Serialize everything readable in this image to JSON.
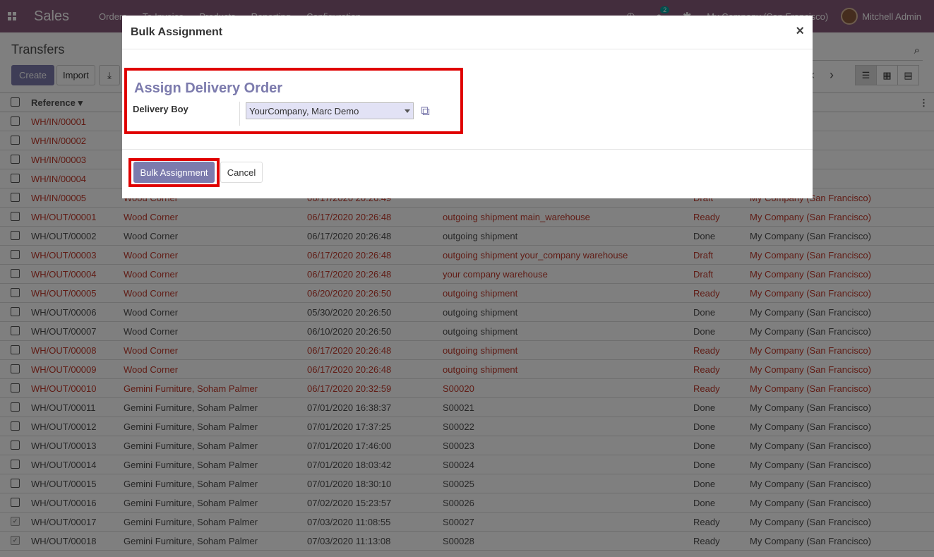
{
  "navbar": {
    "brand": "Sales",
    "menu": [
      "Orders",
      "To Invoice",
      "Products",
      "Reporting",
      "Configuration"
    ],
    "chat_badge": "2",
    "company": "My Company (San Francisco)",
    "user": "Mitchell Admin",
    "apps_icon": "apps-grid-icon",
    "clock_icon": "clock-icon",
    "chat_icon": "chat-icon",
    "settings_icon": "bug-icon"
  },
  "control_panel": {
    "breadcrumb": "Transfers",
    "create_label": "Create",
    "import_label": "Import"
  },
  "list": {
    "headers": {
      "reference": "Reference ▾"
    },
    "rows": [
      {
        "ref": "WH/IN/00001",
        "contact": "",
        "date": "",
        "doc": "",
        "status": "",
        "company": "San Francisco)",
        "red": true
      },
      {
        "ref": "WH/IN/00002",
        "contact": "",
        "date": "",
        "doc": "",
        "status": "",
        "company": "San Francisco)",
        "red": true
      },
      {
        "ref": "WH/IN/00003",
        "contact": "",
        "date": "",
        "doc": "",
        "status": "",
        "company": "San Francisco)",
        "red": true
      },
      {
        "ref": "WH/IN/00004",
        "contact": "",
        "date": "",
        "doc": "",
        "status": "",
        "company": "San Francisco)",
        "red": true
      },
      {
        "ref": "WH/IN/00005",
        "contact": "Wood Corner",
        "date": "06/17/2020 20:26:49",
        "doc": "",
        "status": "Draft",
        "company": "My Company (San Francisco)",
        "red": true
      },
      {
        "ref": "WH/OUT/00001",
        "contact": "Wood Corner",
        "date": "06/17/2020 20:26:48",
        "doc": "outgoing shipment main_warehouse",
        "status": "Ready",
        "company": "My Company (San Francisco)",
        "red": true
      },
      {
        "ref": "WH/OUT/00002",
        "contact": "Wood Corner",
        "date": "06/17/2020 20:26:48",
        "doc": "outgoing shipment",
        "status": "Done",
        "company": "My Company (San Francisco)",
        "red": false
      },
      {
        "ref": "WH/OUT/00003",
        "contact": "Wood Corner",
        "date": "06/17/2020 20:26:48",
        "doc": "outgoing shipment your_company warehouse",
        "status": "Draft",
        "company": "My Company (San Francisco)",
        "red": true
      },
      {
        "ref": "WH/OUT/00004",
        "contact": "Wood Corner",
        "date": "06/17/2020 20:26:48",
        "doc": "your company warehouse",
        "status": "Draft",
        "company": "My Company (San Francisco)",
        "red": true
      },
      {
        "ref": "WH/OUT/00005",
        "contact": "Wood Corner",
        "date": "06/20/2020 20:26:50",
        "doc": "outgoing shipment",
        "status": "Ready",
        "company": "My Company (San Francisco)",
        "red": true
      },
      {
        "ref": "WH/OUT/00006",
        "contact": "Wood Corner",
        "date": "05/30/2020 20:26:50",
        "doc": "outgoing shipment",
        "status": "Done",
        "company": "My Company (San Francisco)",
        "red": false
      },
      {
        "ref": "WH/OUT/00007",
        "contact": "Wood Corner",
        "date": "06/10/2020 20:26:50",
        "doc": "outgoing shipment",
        "status": "Done",
        "company": "My Company (San Francisco)",
        "red": false
      },
      {
        "ref": "WH/OUT/00008",
        "contact": "Wood Corner",
        "date": "06/17/2020 20:26:48",
        "doc": "outgoing shipment",
        "status": "Ready",
        "company": "My Company (San Francisco)",
        "red": true
      },
      {
        "ref": "WH/OUT/00009",
        "contact": "Wood Corner",
        "date": "06/17/2020 20:26:48",
        "doc": "outgoing shipment",
        "status": "Ready",
        "company": "My Company (San Francisco)",
        "red": true
      },
      {
        "ref": "WH/OUT/00010",
        "contact": "Gemini Furniture, Soham Palmer",
        "date": "06/17/2020 20:32:59",
        "doc": "S00020",
        "status": "Ready",
        "company": "My Company (San Francisco)",
        "red": true
      },
      {
        "ref": "WH/OUT/00011",
        "contact": "Gemini Furniture, Soham Palmer",
        "date": "07/01/2020 16:38:37",
        "doc": "S00021",
        "status": "Done",
        "company": "My Company (San Francisco)",
        "red": false
      },
      {
        "ref": "WH/OUT/00012",
        "contact": "Gemini Furniture, Soham Palmer",
        "date": "07/01/2020 17:37:25",
        "doc": "S00022",
        "status": "Done",
        "company": "My Company (San Francisco)",
        "red": false
      },
      {
        "ref": "WH/OUT/00013",
        "contact": "Gemini Furniture, Soham Palmer",
        "date": "07/01/2020 17:46:00",
        "doc": "S00023",
        "status": "Done",
        "company": "My Company (San Francisco)",
        "red": false
      },
      {
        "ref": "WH/OUT/00014",
        "contact": "Gemini Furniture, Soham Palmer",
        "date": "07/01/2020 18:03:42",
        "doc": "S00024",
        "status": "Done",
        "company": "My Company (San Francisco)",
        "red": false
      },
      {
        "ref": "WH/OUT/00015",
        "contact": "Gemini Furniture, Soham Palmer",
        "date": "07/01/2020 18:30:10",
        "doc": "S00025",
        "status": "Done",
        "company": "My Company (San Francisco)",
        "red": false
      },
      {
        "ref": "WH/OUT/00016",
        "contact": "Gemini Furniture, Soham Palmer",
        "date": "07/02/2020 15:23:57",
        "doc": "S00026",
        "status": "Done",
        "company": "My Company (San Francisco)",
        "red": false
      },
      {
        "ref": "WH/OUT/00017",
        "contact": "Gemini Furniture, Soham Palmer",
        "date": "07/03/2020 11:08:55",
        "doc": "S00027",
        "status": "Ready",
        "company": "My Company (San Francisco)",
        "red": false,
        "checked": true
      },
      {
        "ref": "WH/OUT/00018",
        "contact": "Gemini Furniture, Soham Palmer",
        "date": "07/03/2020 11:13:08",
        "doc": "S00028",
        "status": "Ready",
        "company": "My Company (San Francisco)",
        "red": false,
        "checked": true
      }
    ]
  },
  "modal": {
    "title": "Bulk Assignment",
    "close_symbol": "×",
    "form_title": "Assign Delivery Order",
    "field_label": "Delivery Boy",
    "field_value": "YourCompany, Marc Demo",
    "primary_label": "Bulk Assignment",
    "cancel_label": "Cancel",
    "highlight_color": "#e00000",
    "accent_color": "#7c7bad"
  },
  "colors": {
    "navbar": "#875a7b",
    "primary": "#7c7bad",
    "danger_text": "#c0392b"
  }
}
